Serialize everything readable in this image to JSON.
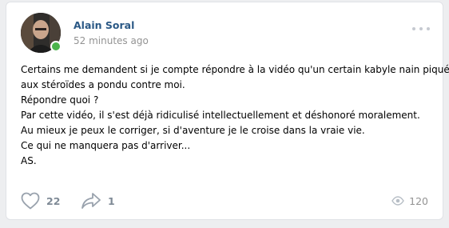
{
  "post": {
    "author": "Alain Soral",
    "timestamp": "52 minutes ago",
    "lines": [
      "Certains me demandent si je compte répondre à la vidéo qu'un certain kabyle nain piqué",
      "aux stéroïdes a pondu contre moi.",
      "Répondre quoi ?",
      "Par cette vidéo, il s'est déjà ridiculisé intellectuellement et déshonoré moralement.",
      "Au mieux je peux le corriger, si d'aventure je le croise dans la vraie vie.",
      "Ce qui ne manquera pas d'arriver...",
      "AS."
    ]
  },
  "actions": {
    "likes": "22",
    "shares": "1",
    "views": "120"
  },
  "colors": {
    "background": "#edeef0",
    "author_link": "#2a5885",
    "online": "#4bb34b",
    "muted": "#939393"
  },
  "icons": {
    "like": "heart-icon",
    "share": "share-arrow-icon",
    "views": "eye-icon",
    "more": "more-dots-icon"
  }
}
